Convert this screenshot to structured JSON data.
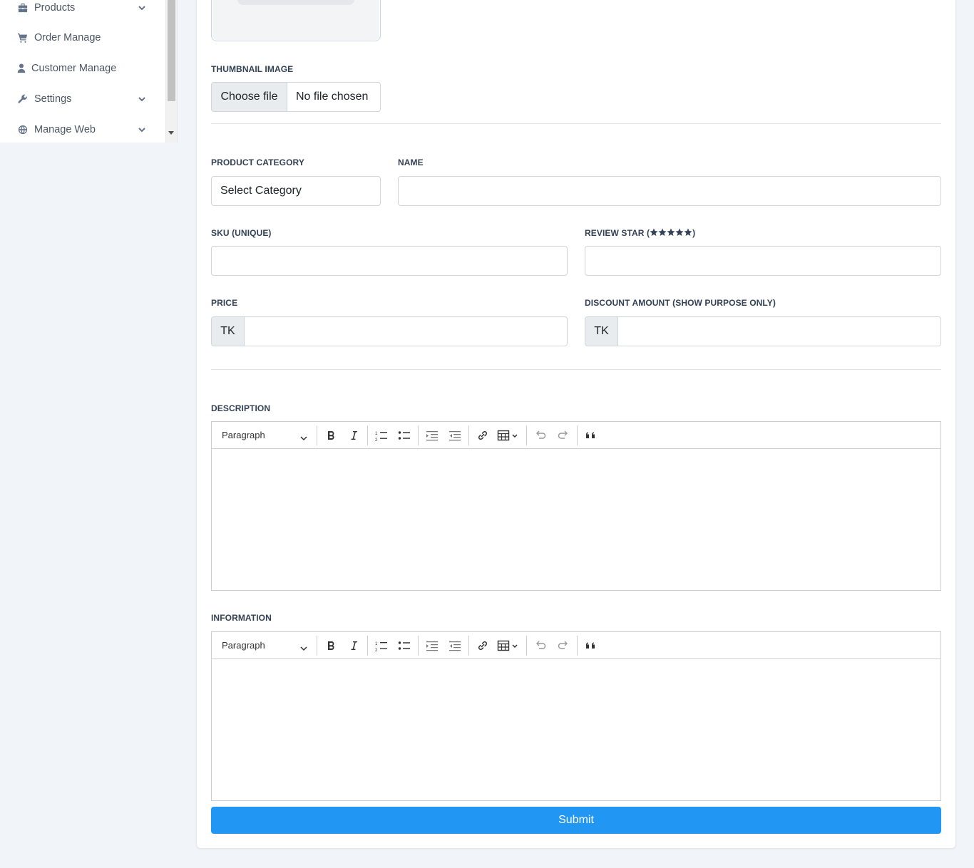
{
  "sidebar": {
    "items": [
      {
        "label": "Products",
        "icon": "briefcase-icon",
        "expandable": true
      },
      {
        "label": "Order Manage",
        "icon": "cart-icon",
        "expandable": false
      },
      {
        "label": "Customer Manage",
        "icon": "user-icon",
        "expandable": false
      },
      {
        "label": "Settings",
        "icon": "wrench-icon",
        "expandable": true
      },
      {
        "label": "Manage Web",
        "icon": "globe-icon",
        "expandable": true
      }
    ]
  },
  "form": {
    "thumbnail": {
      "label": "THUMBNAIL IMAGE",
      "button": "Choose file",
      "status": "No file chosen"
    },
    "category": {
      "label": "PRODUCT CATEGORY",
      "value": "Select Category"
    },
    "name": {
      "label": "NAME",
      "value": ""
    },
    "sku": {
      "label": "SKU (UNIQUE)",
      "value": ""
    },
    "review": {
      "label_prefix": "REVIEW STAR (",
      "label_suffix": ")",
      "stars": 5,
      "value": ""
    },
    "price": {
      "label": "PRICE",
      "currency": "TK",
      "value": ""
    },
    "discount": {
      "label": "DISCOUNT AMOUNT (SHOW PURPOSE ONLY)",
      "currency": "TK",
      "value": ""
    },
    "description": {
      "label": "DESCRIPTION",
      "heading_select": "Paragraph"
    },
    "information": {
      "label": "INFORMATION",
      "heading_select": "Paragraph"
    },
    "submit": "Submit"
  },
  "colors": {
    "accent": "#2196f3",
    "sidebar_text": "#4b5563",
    "background": "#f1f4f9"
  }
}
